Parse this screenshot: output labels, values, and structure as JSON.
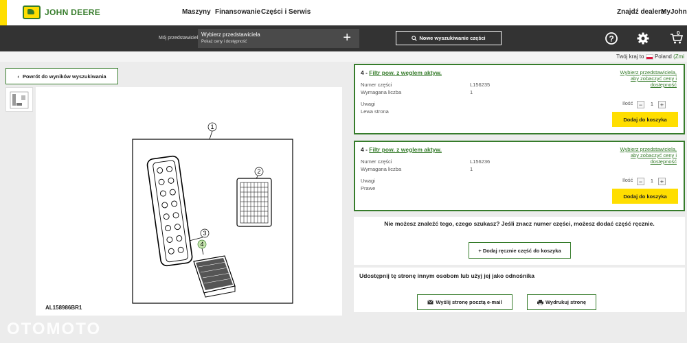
{
  "brand": {
    "logo_text": "JOHN DEERE"
  },
  "nav": {
    "items": [
      "Maszyny",
      "Finansowanie",
      "Części i Serwis"
    ],
    "find_dealer": "Znajdź dealera",
    "myjd": "MyJohnDe"
  },
  "toolbar": {
    "dealer_label": "Mój przedstawiciel",
    "dealer_title": "Wybierz przedstawiciela",
    "dealer_sub": "Pokaż ceny i dostępność",
    "new_search": "Nowe wyszukiwanie części",
    "cart_count": "0"
  },
  "country": {
    "label": "Twój kraj to",
    "name": "Poland",
    "change": "(Zmi"
  },
  "back_label": "Powrót do wyników wyszukiwania",
  "diagram": {
    "ref": "AL158986BR1",
    "callouts": [
      "1",
      "2",
      "3",
      "4"
    ]
  },
  "parts": [
    {
      "prefix": "4 -",
      "name": "Filtr pow. z węglem aktyw.",
      "part_no_label": "Numer części",
      "part_no": "L156235",
      "qty_req_label": "Wymagana liczba",
      "qty_req": "1",
      "notes_label": "Uwagi",
      "notes": "Lewa strona",
      "dealer_link": "Wybierz przedstawiciela, aby zobaczyć ceny i dostępność",
      "qty_label": "Ilość",
      "qty": "1",
      "add_label": "Dodaj do koszyka"
    },
    {
      "prefix": "4 -",
      "name": "Filtr pow. z węglem aktyw.",
      "part_no_label": "Numer części",
      "part_no": "L156236",
      "qty_req_label": "Wymagana liczba",
      "qty_req": "1",
      "notes_label": "Uwagi",
      "notes": "Prawe",
      "dealer_link": "Wybierz przedstawiciela, aby zobaczyć ceny i dostępność",
      "qty_label": "Ilość",
      "qty": "1",
      "add_label": "Dodaj do koszyka"
    }
  ],
  "manual": {
    "message": "Nie możesz znaleźć tego, czego szukasz? Jeśli znacz numer części, możesz dodać część ręcznie.",
    "button": "+ Dodaj ręcznie część do koszyka"
  },
  "share": {
    "title": "Udostępnij tę stronę innym osobom lub użyj jej jako odnośnika",
    "email": "Wyślij stronę pocztą e-mail",
    "print": "Wydrukuj stronę"
  },
  "watermark": "OTOMOTO",
  "colors": {
    "brand_green": "#367c2b",
    "brand_yellow": "#ffde00",
    "dark_bar": "#333333"
  }
}
